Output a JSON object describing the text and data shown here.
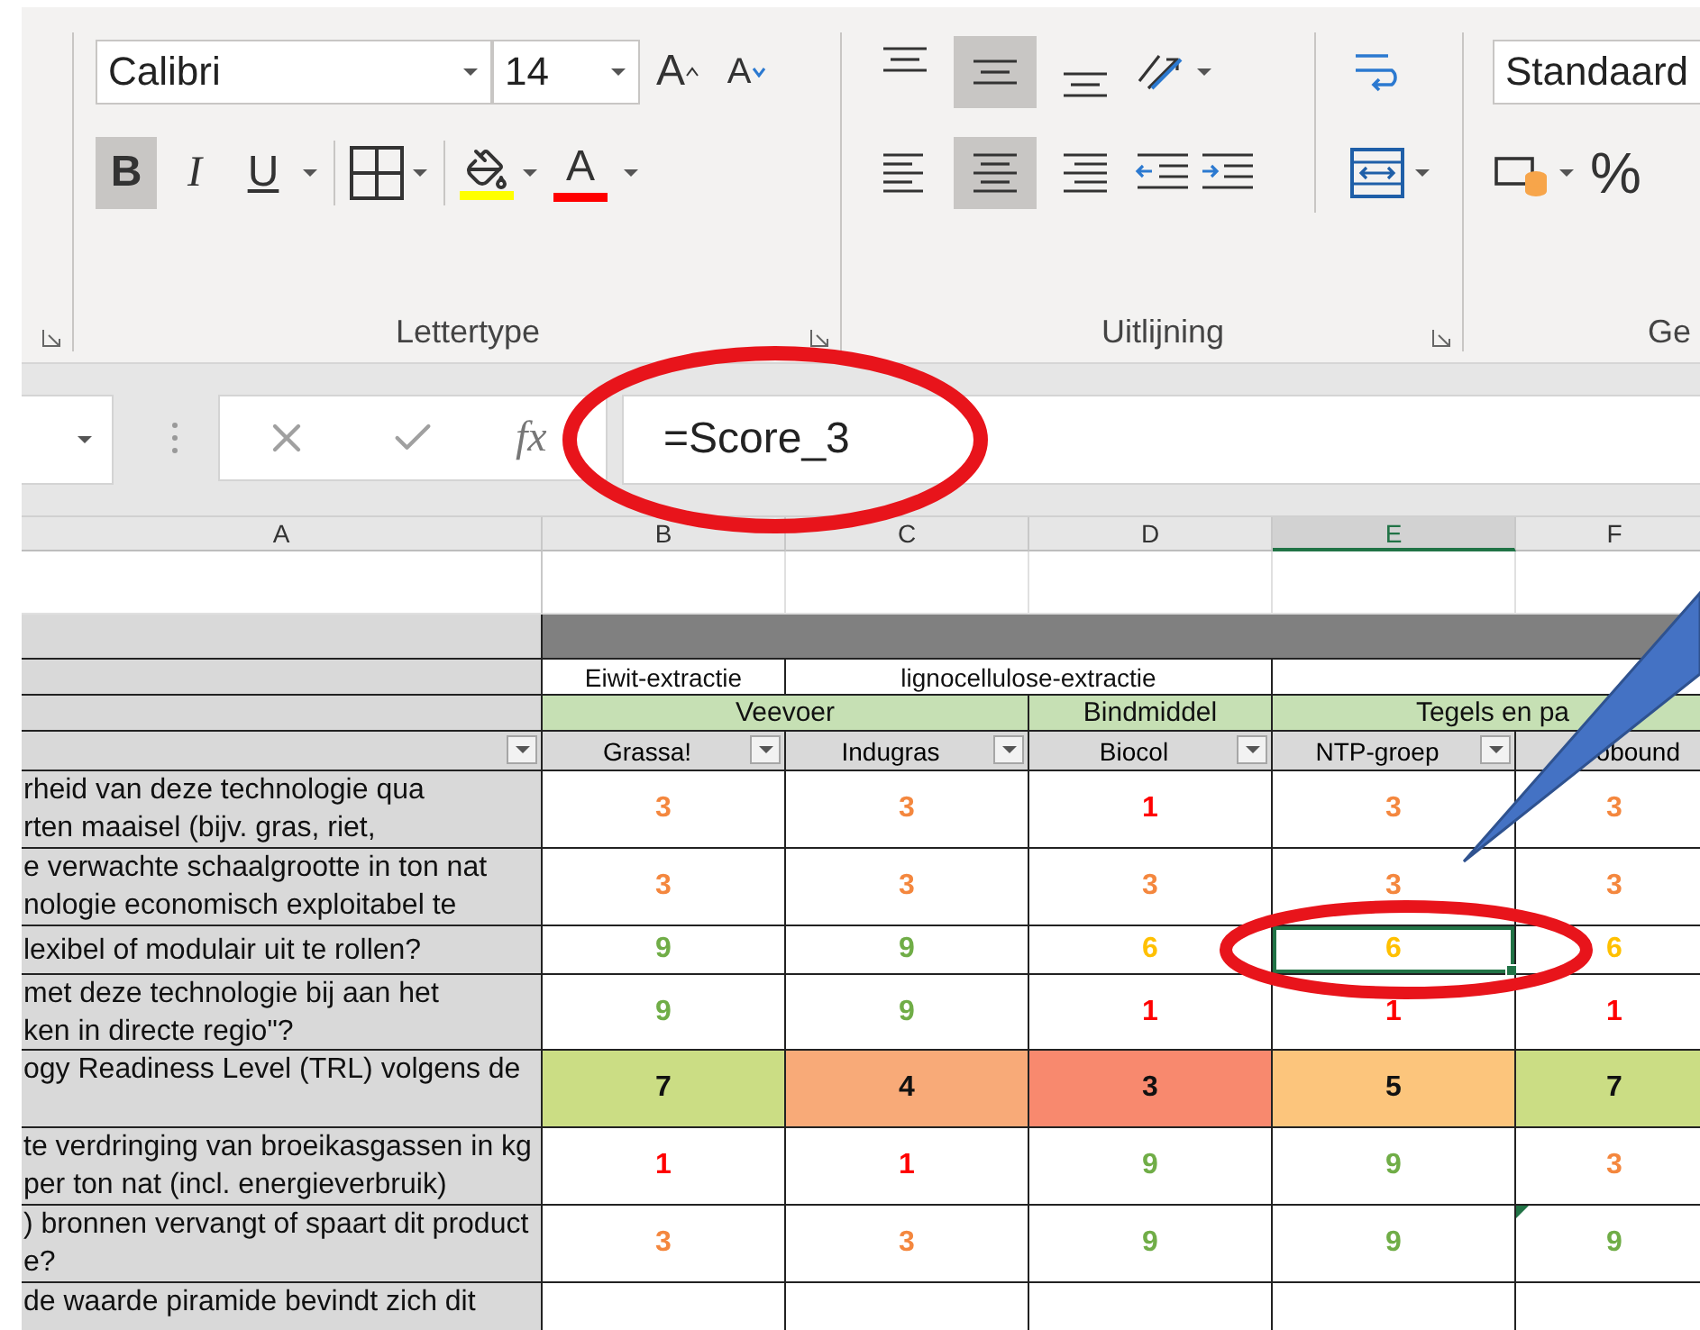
{
  "ribbon": {
    "font_group": {
      "label": "Lettertype",
      "font": "Calibri",
      "size": "14",
      "grow": "A",
      "shrink": "A",
      "font_color": "A",
      "buttons": [
        {
          "kind": "bold",
          "label": "B",
          "selected": true
        },
        {
          "kind": "italic",
          "label": "I",
          "selected": false
        },
        {
          "kind": "underline",
          "label": "U",
          "selected": false
        }
      ]
    },
    "alignment_group": {
      "label": "Uitlijning",
      "vertical": [
        {
          "kind": "top",
          "selected": false
        },
        {
          "kind": "middle",
          "selected": true
        },
        {
          "kind": "bottom",
          "selected": false
        }
      ],
      "horizontal": [
        {
          "kind": "left",
          "selected": false
        },
        {
          "kind": "center",
          "selected": true
        },
        {
          "kind": "right",
          "selected": false
        }
      ]
    },
    "number_group": {
      "label": "Ge",
      "format": "Standaard",
      "percent": "%"
    }
  },
  "formula_bar": {
    "fx": "fx",
    "formula": "=Score_3"
  },
  "columns": [
    {
      "label": "A",
      "selected": false
    },
    {
      "label": "B",
      "selected": false
    },
    {
      "label": "C",
      "selected": false
    },
    {
      "label": "D",
      "selected": false
    },
    {
      "label": "E",
      "selected": true
    },
    {
      "label": "F",
      "selected": false
    }
  ],
  "sheet": {
    "process_row": [
      {
        "text": "Eiwit-extractie"
      },
      {
        "text": "lignocellulose-extractie"
      }
    ],
    "category_row": [
      {
        "text": "Veevoer"
      },
      {
        "text": "Bindmiddel"
      },
      {
        "text": "Tegels en pa"
      }
    ],
    "names": [
      {
        "text": "Grassa!",
        "filter": true
      },
      {
        "text": "Indugras",
        "filter": true
      },
      {
        "text": "Biocol",
        "filter": true
      },
      {
        "text": "NTP-groep",
        "filter": true
      },
      {
        "text": "obound",
        "filter": false
      }
    ],
    "rows": [
      {
        "kind": "score",
        "label": "rheid van deze technologie qua\nrten maaisel (bijv. gras, riet,",
        "cells": [
          {
            "value": "3",
            "color": "#f4873e"
          },
          {
            "value": "3",
            "color": "#f4873e"
          },
          {
            "value": "1",
            "color": "#ff0000"
          },
          {
            "value": "3",
            "color": "#f4873e"
          },
          {
            "value": "3",
            "color": "#f4873e"
          }
        ]
      },
      {
        "kind": "score",
        "label": "e verwachte schaalgrootte in ton nat\nnologie economisch exploitabel te",
        "cells": [
          {
            "value": "3",
            "color": "#f4873e"
          },
          {
            "value": "3",
            "color": "#f4873e"
          },
          {
            "value": "3",
            "color": "#f4873e"
          },
          {
            "value": "3",
            "color": "#f4873e"
          },
          {
            "value": "3",
            "color": "#f4873e"
          }
        ]
      },
      {
        "kind": "score",
        "label": "lexibel of modulair uit te rollen?",
        "cells": [
          {
            "value": "9",
            "color": "#70ad47"
          },
          {
            "value": "9",
            "color": "#70ad47"
          },
          {
            "value": "6",
            "color": "#ffc000"
          },
          {
            "value": "6",
            "color": "#ffc000",
            "selected": true
          },
          {
            "value": "6",
            "color": "#ffc000"
          }
        ]
      },
      {
        "kind": "score",
        "label": "met deze technologie bij aan het\nken in directe regio\"?",
        "cells": [
          {
            "value": "9",
            "color": "#70ad47"
          },
          {
            "value": "9",
            "color": "#70ad47"
          },
          {
            "value": "1",
            "color": "#ff0000"
          },
          {
            "value": "1",
            "color": "#ff0000"
          },
          {
            "value": "1",
            "color": "#ff0000"
          }
        ]
      },
      {
        "kind": "trl",
        "label": "ogy Readiness Level (TRL) volgens de",
        "cells": [
          {
            "value": "7",
            "color": "#cbdd84"
          },
          {
            "value": "4",
            "color": "#f8aa78"
          },
          {
            "value": "3",
            "color": "#f8896e"
          },
          {
            "value": "5",
            "color": "#fcc57c"
          },
          {
            "value": "7",
            "color": "#cbdd84"
          }
        ]
      },
      {
        "kind": "score",
        "label": "te verdringing van broeikasgassen in kg\nper ton nat (incl. energieverbruik)",
        "cells": [
          {
            "value": "1",
            "color": "#ff0000"
          },
          {
            "value": "1",
            "color": "#ff0000"
          },
          {
            "value": "9",
            "color": "#70ad47"
          },
          {
            "value": "9",
            "color": "#70ad47"
          },
          {
            "value": "3",
            "color": "#f4873e"
          }
        ]
      },
      {
        "kind": "score",
        "label": ") bronnen vervangt of spaart dit product\ne?",
        "cells": [
          {
            "value": "3",
            "color": "#f4873e"
          },
          {
            "value": "3",
            "color": "#f4873e"
          },
          {
            "value": "9",
            "color": "#70ad47"
          },
          {
            "value": "9",
            "color": "#70ad47"
          },
          {
            "value": "9",
            "color": "#70ad47",
            "comment": true
          }
        ]
      },
      {
        "kind": "score",
        "label": "de waarde piramide bevindt zich dit"
      }
    ]
  },
  "annotations": [
    {
      "kind": "ellipse"
    },
    {
      "kind": "ellipse"
    },
    {
      "kind": "callout"
    }
  ]
}
